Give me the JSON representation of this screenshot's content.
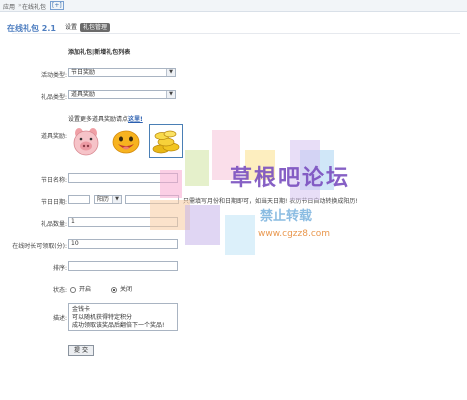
{
  "breadcrumb": {
    "item1": "应用",
    "sep": "»",
    "item2": "在线礼包",
    "action": "[+]"
  },
  "header": {
    "title": "在线礼包 2.1",
    "tabs": [
      "设置",
      "礼包管理"
    ]
  },
  "section_title": "添加礼包|新增礼包列表",
  "form": {
    "activity_type": {
      "label": "活动类型:",
      "value": "节日奖励"
    },
    "gift_type": {
      "label": "礼品类型:",
      "value": "道具奖励"
    },
    "reward_hint": "设置更多道具奖励请点",
    "reward_link": "这里!",
    "reward_label": "道具奖励:",
    "reward_icons": [
      "pig-face-icon",
      "smiley-face-icon",
      "gold-coins-icon"
    ],
    "festival_name": {
      "label": "节日名称:",
      "value": ""
    },
    "festival_date": {
      "label": "节日日期:",
      "select_value": "阳历",
      "note": "只需填写月份和日期即可，如当天日期! 农历节日自动转换成阳历!"
    },
    "gift_count": {
      "label": "礼品数量:",
      "value": "1"
    },
    "online_minutes": {
      "label": "在线时长可领取(分):",
      "value": "10"
    },
    "sort": {
      "label": "排序:",
      "value": ""
    },
    "status": {
      "label": "状态:",
      "options": [
        "开启",
        "关闭"
      ],
      "selected": "关闭"
    },
    "description": {
      "label": "描述:",
      "lines": [
        "金钱卡",
        "可以随机获得特定积分",
        "成功领取该奖品后翻倍下一个奖品!"
      ]
    },
    "submit_label": "提 交"
  },
  "watermark": {
    "line1": "草根吧论坛",
    "line2": "禁止转载",
    "line3": "www.cgzz8.com"
  }
}
